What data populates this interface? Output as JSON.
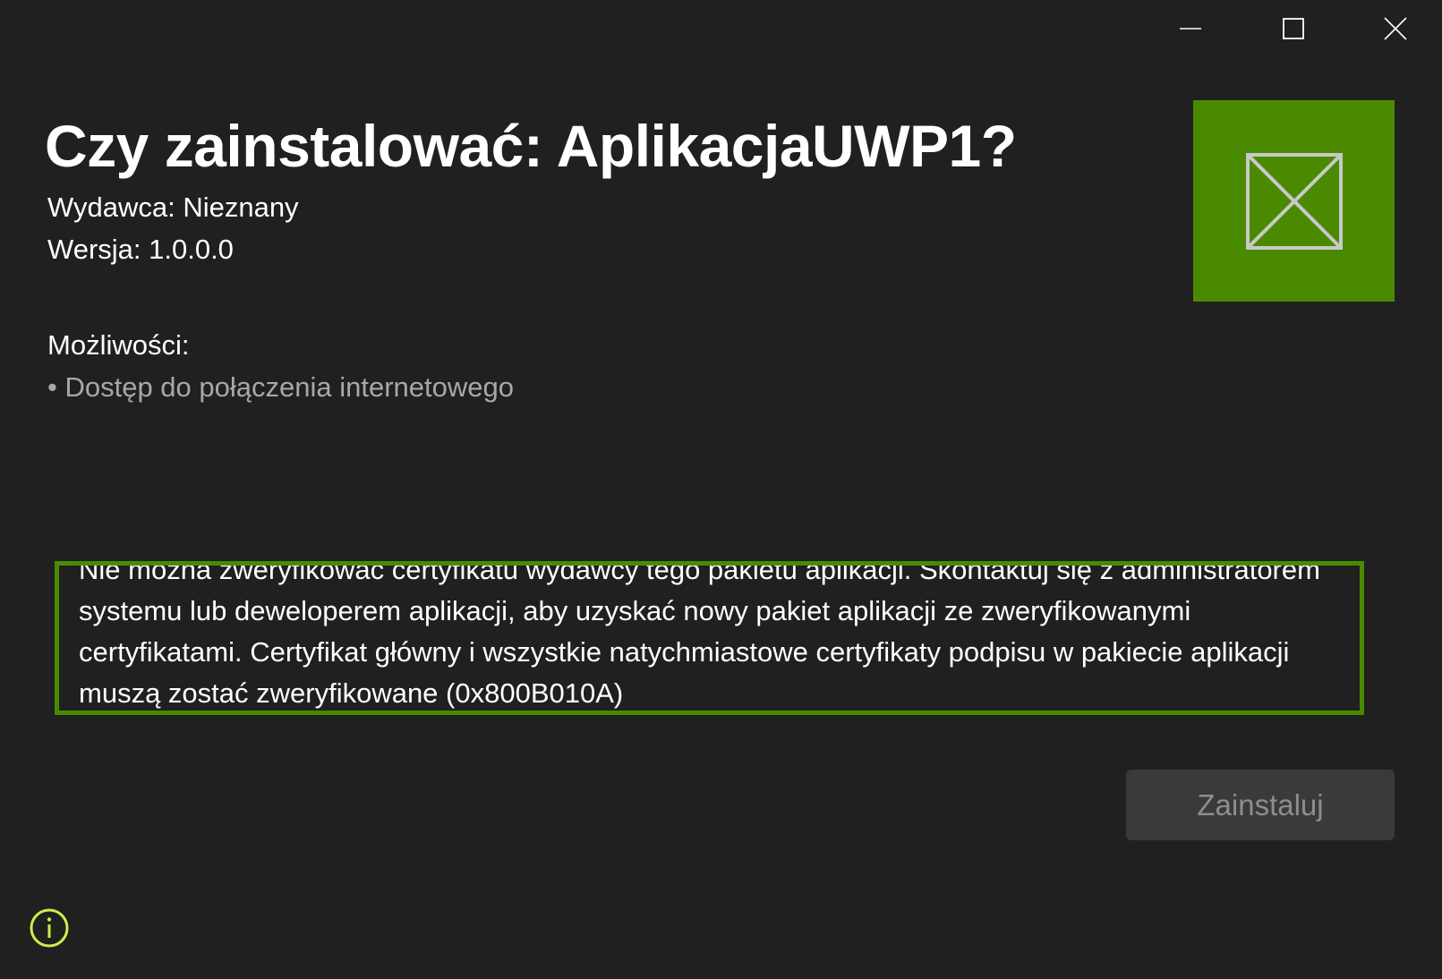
{
  "window": {
    "controls": {
      "minimize_icon": "minimize-icon",
      "maximize_icon": "maximize-icon",
      "close_icon": "close-icon"
    }
  },
  "installer": {
    "title": "Czy zainstalować: AplikacjaUWP1?",
    "publisher": "Wydawca: Nieznany",
    "version": "Wersja: 1.0.0.0",
    "capabilities_title": "Możliwości:",
    "capabilities": [
      "• Dostęp do połączenia internetowego"
    ],
    "error_message": "Nie można zweryfikować certyfikatu wydawcy tego pakietu aplikacji. Skontaktuj się z administratorem systemu lub deweloperem aplikacji, aby uzyskać nowy pakiet aplikacji ze zweryfikowanymi certyfikatami. Certyfikat główny i wszystkie natychmiastowe certyfikaty podpisu w pakiecie aplikacji muszą zostać zweryfikowane (0x800B010A)",
    "install_button": "Zainstaluj"
  },
  "colors": {
    "background": "#202020",
    "accent": "#4a8a00",
    "info_icon": "#c8f04a",
    "disabled_button_bg": "#3a3a3a",
    "disabled_button_text": "#8e8e8e"
  },
  "icons": {
    "app_tile": "placeholder-app-icon",
    "info": "info-icon"
  }
}
